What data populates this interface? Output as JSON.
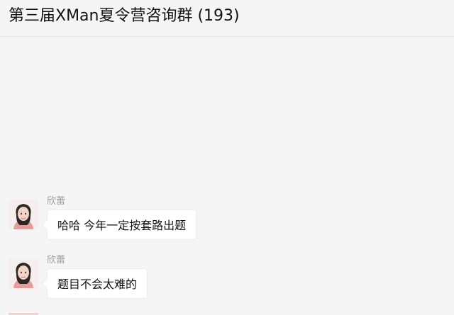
{
  "header": {
    "title": "第三届XMan夏令营咨询群 (193)"
  },
  "messages": [
    {
      "sender": "欣蕾",
      "text": "哈哈 今年一定按套路出题"
    },
    {
      "sender": "欣蕾",
      "text": "题目不会太难的"
    }
  ],
  "colors": {
    "background": "#f5f5f5",
    "bubble": "#ffffff",
    "sender_text": "#9a9a9a",
    "title_text": "#111111"
  },
  "icons": {
    "avatar": "user-avatar-photo"
  }
}
